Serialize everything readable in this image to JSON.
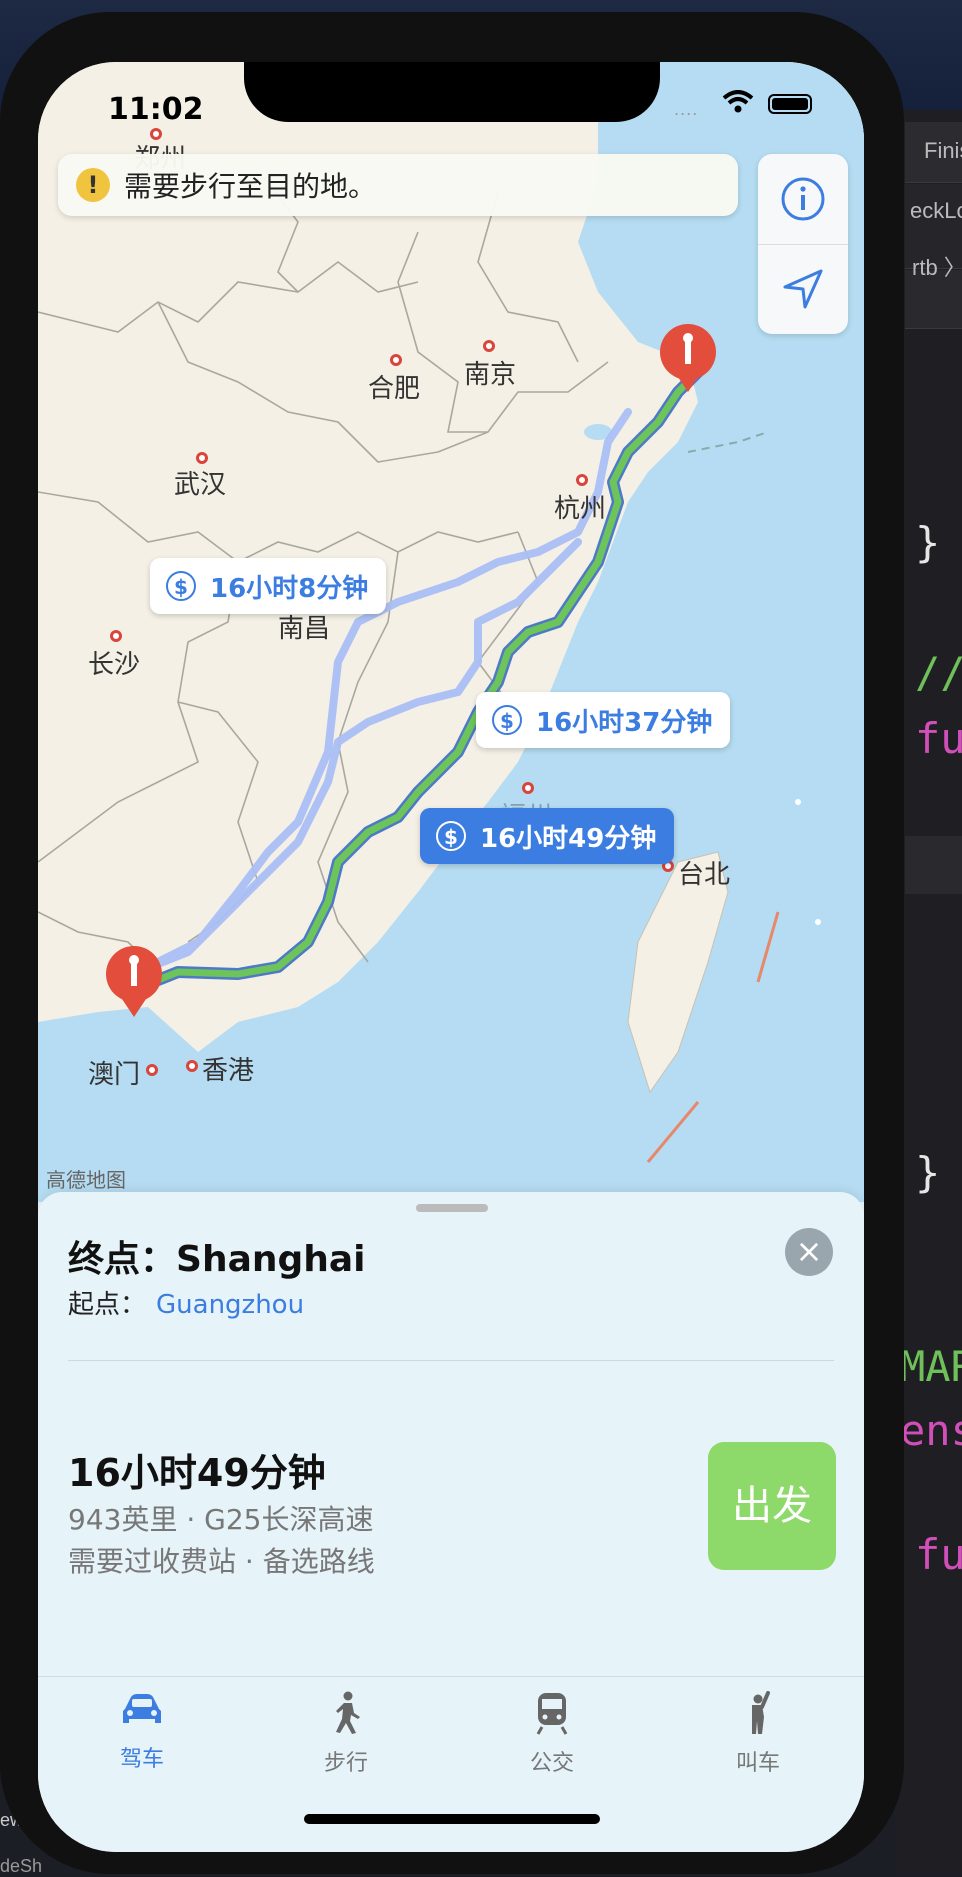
{
  "status_bar": {
    "time": "11:02",
    "signal": "....",
    "battery_icon": "battery-full-icon",
    "wifi_icon": "wifi-icon"
  },
  "map": {
    "notice": {
      "icon": "!",
      "text": "需要步行至目的地。"
    },
    "controls": {
      "info_icon": "info-icon",
      "locate_icon": "location-arrow-icon"
    },
    "cities": {
      "zhengzhou": "郑州",
      "hefei": "合肥",
      "nanjing": "南京",
      "wuhan": "武汉",
      "hangzhou": "杭州",
      "nanchang": "南昌",
      "changsha": "长沙",
      "fuzhou": "福州",
      "taipei": "台北",
      "macau": "澳门",
      "hongkong": "香港"
    },
    "routes": [
      {
        "label": "16小时8分钟",
        "icon": "$",
        "selected": false
      },
      {
        "label": "16小时37分钟",
        "icon": "$",
        "selected": false
      },
      {
        "label": "16小时49分钟",
        "icon": "$",
        "selected": true
      }
    ],
    "attribution": "高德地图",
    "colors": {
      "selected_route": "#6cc45a",
      "alt_route": "#aabff5",
      "pin": "#e34d3c",
      "accent": "#3b7de0"
    }
  },
  "sheet": {
    "destination_label": "终点：",
    "destination": "Shanghai",
    "origin_label": "起点：",
    "origin": "Guangzhou",
    "close_icon": "×",
    "duration": "16小时49分钟",
    "detail_line1": "943英里 · G25长深高速",
    "detail_line2": "需要过收费站 · 备选路线",
    "go_label": "出发"
  },
  "tabs": [
    {
      "label": "驾车",
      "icon": "car-icon",
      "active": true
    },
    {
      "label": "步行",
      "icon": "walk-icon",
      "active": false
    },
    {
      "label": "公交",
      "icon": "train-icon",
      "active": false
    },
    {
      "label": "叫车",
      "icon": "hail-icon",
      "active": false
    }
  ],
  "background_editor": {
    "button_fragment": "Finis",
    "line_fragment1": "eckLo",
    "breadcrumb_fragment": "rtb 〉",
    "brace1": "}",
    "comment": "//",
    "func1": "fu",
    "brace2": "}",
    "mark": "MAR",
    "ext": "ens",
    "func2": "fu",
    "bottom_left1": "ewC",
    "bottom_left2": "deSh"
  }
}
